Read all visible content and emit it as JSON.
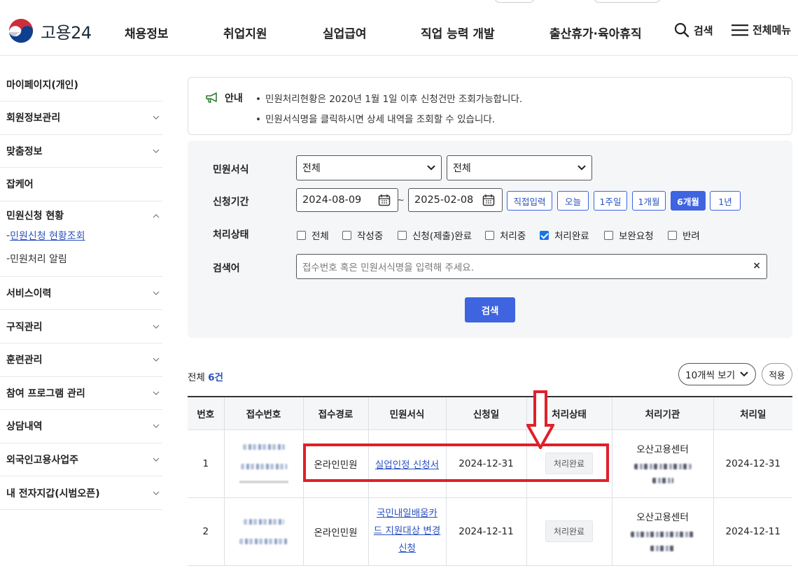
{
  "header": {
    "logo_text": "고용24",
    "nav": [
      "채용정보",
      "취업지원",
      "실업급여",
      "직업 능력 개발",
      "출산휴가·육아휴직"
    ],
    "search_label": "검색",
    "menu_label": "전체메뉴"
  },
  "sidebar": {
    "items": [
      {
        "label": "마이페이지(개인)"
      },
      {
        "label": "회원정보관리"
      },
      {
        "label": "맞춤정보"
      },
      {
        "label": "잡케어"
      }
    ],
    "group": {
      "label": "민원신청 현황",
      "subs": [
        {
          "label": "민원신청 현황조회",
          "active": true
        },
        {
          "label": "민원처리 알림",
          "active": false
        }
      ]
    },
    "items2": [
      {
        "label": "서비스이력"
      },
      {
        "label": "구직관리"
      },
      {
        "label": "훈련관리"
      },
      {
        "label": "참여 프로그램 관리"
      },
      {
        "label": "상담내역"
      },
      {
        "label": "외국인고용사업주"
      },
      {
        "label": "내 전자지갑(시범오픈)"
      }
    ]
  },
  "notice": {
    "label": "안내",
    "lines": [
      "민원처리현황은 2020년 1월 1일 이후 신청건만 조회가능합니다.",
      "민원서식명을 클릭하시면 상세 내역을 조회할 수 있습니다."
    ]
  },
  "form": {
    "type_label": "민원서식",
    "type_select1": "전체",
    "type_select2": "전체",
    "period_label": "신청기간",
    "date_from": "2024-08-09",
    "date_to": "2025-02-08",
    "tilde": "~",
    "period_buttons": [
      "직접입력",
      "오늘",
      "1주일",
      "1개월",
      "6개월",
      "1년"
    ],
    "period_selected": "6개월",
    "status_label": "처리상태",
    "statuses": [
      {
        "label": "전체",
        "checked": false
      },
      {
        "label": "작성중",
        "checked": false
      },
      {
        "label": "신청(제출)완료",
        "checked": false
      },
      {
        "label": "처리중",
        "checked": false
      },
      {
        "label": "처리완료",
        "checked": true
      },
      {
        "label": "보완요청",
        "checked": false
      },
      {
        "label": "반려",
        "checked": false
      }
    ],
    "keyword_label": "검색어",
    "keyword_placeholder": "접수번호 혹은 민원서식명을 입력해 주세요.",
    "clear": "×",
    "search_button": "검색"
  },
  "results": {
    "total_prefix": "전체",
    "total_count": "6건",
    "page_size": "10개씩 보기",
    "apply": "적용",
    "columns": [
      "번호",
      "접수번호",
      "접수경로",
      "민원서식",
      "신청일",
      "처리상태",
      "처리기관",
      "처리일"
    ],
    "rows": [
      {
        "no": "1",
        "route": "온라인민원",
        "form": "실업인정 신청서",
        "applied": "2024-12-31",
        "status": "처리완료",
        "org": "오산고용센터",
        "processed": "2024-12-31"
      },
      {
        "no": "2",
        "route": "온라인민원",
        "form": "국민내일배움카드 지원대상 변경 신청",
        "applied": "2024-12-11",
        "status": "처리완료",
        "org": "오산고용센터",
        "processed": "2024-12-11"
      }
    ]
  },
  "colors": {
    "primary": "#3e64e0",
    "link": "#2a52be",
    "annotation": "#e0202a"
  }
}
